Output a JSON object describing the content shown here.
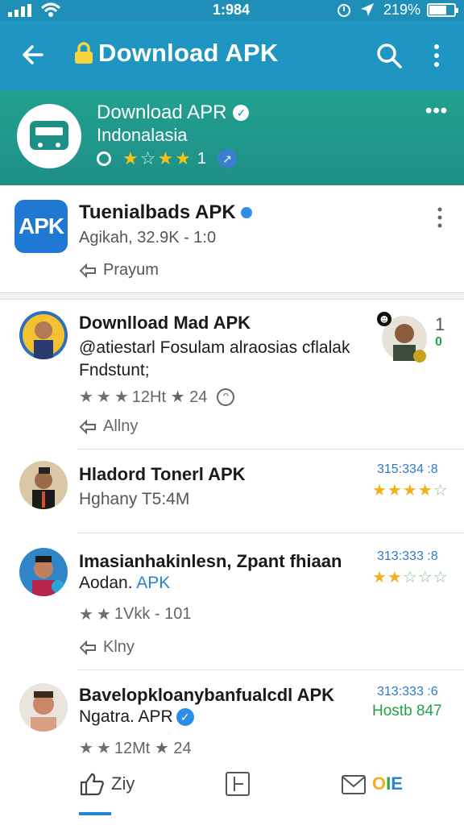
{
  "status_bar": {
    "time": "1:984",
    "battery_text": "219%",
    "battery_level": 0.7
  },
  "app_bar": {
    "title": "Download APK",
    "icons": [
      "back-arrow-icon",
      "lock-icon",
      "search-icon",
      "overflow-menu-icon"
    ]
  },
  "channel": {
    "name": "Download APR",
    "subtitle": "Indonalasia",
    "rating_count": "1",
    "rating_stars": "2.5 of 4",
    "more": "•••"
  },
  "top_app": {
    "icon_text": "APK",
    "name": "Tuenialbads APK",
    "info": "Agikah, 32.9K - 1:0",
    "action": "Prayum"
  },
  "items": [
    {
      "title": "Downlload Mad APK",
      "line1": "@atiestarl Fosulam alraosias cflalak",
      "line2": "Fndstunt;",
      "stats": "12Ht ★ 24",
      "action": "Allny",
      "side_count": "1",
      "side_count2": "0"
    },
    {
      "title": "Hladord Tonerl APK",
      "line1": "Hghany T5:4M",
      "side_num": "315:334 :8",
      "side_rating": 4.5
    },
    {
      "title": "Imasianhakinlesn, Zpant fhiaan",
      "line1_prefix": "Aodan.",
      "line1_suffix": "APK",
      "stats": "1Vkk - 101",
      "action": "Klny",
      "side_num": "313:333 :8",
      "side_rating": 2.5
    },
    {
      "title": "Bavelopklоanybanfualcdl APK",
      "line1": "Ngatra. APR",
      "stats": "12Mt ★ 24",
      "side_num": "313:333 :6",
      "side_text": "Hostb 847"
    }
  ],
  "bottom_nav": {
    "like_label": "Ziy",
    "brand_text": "OIE"
  }
}
